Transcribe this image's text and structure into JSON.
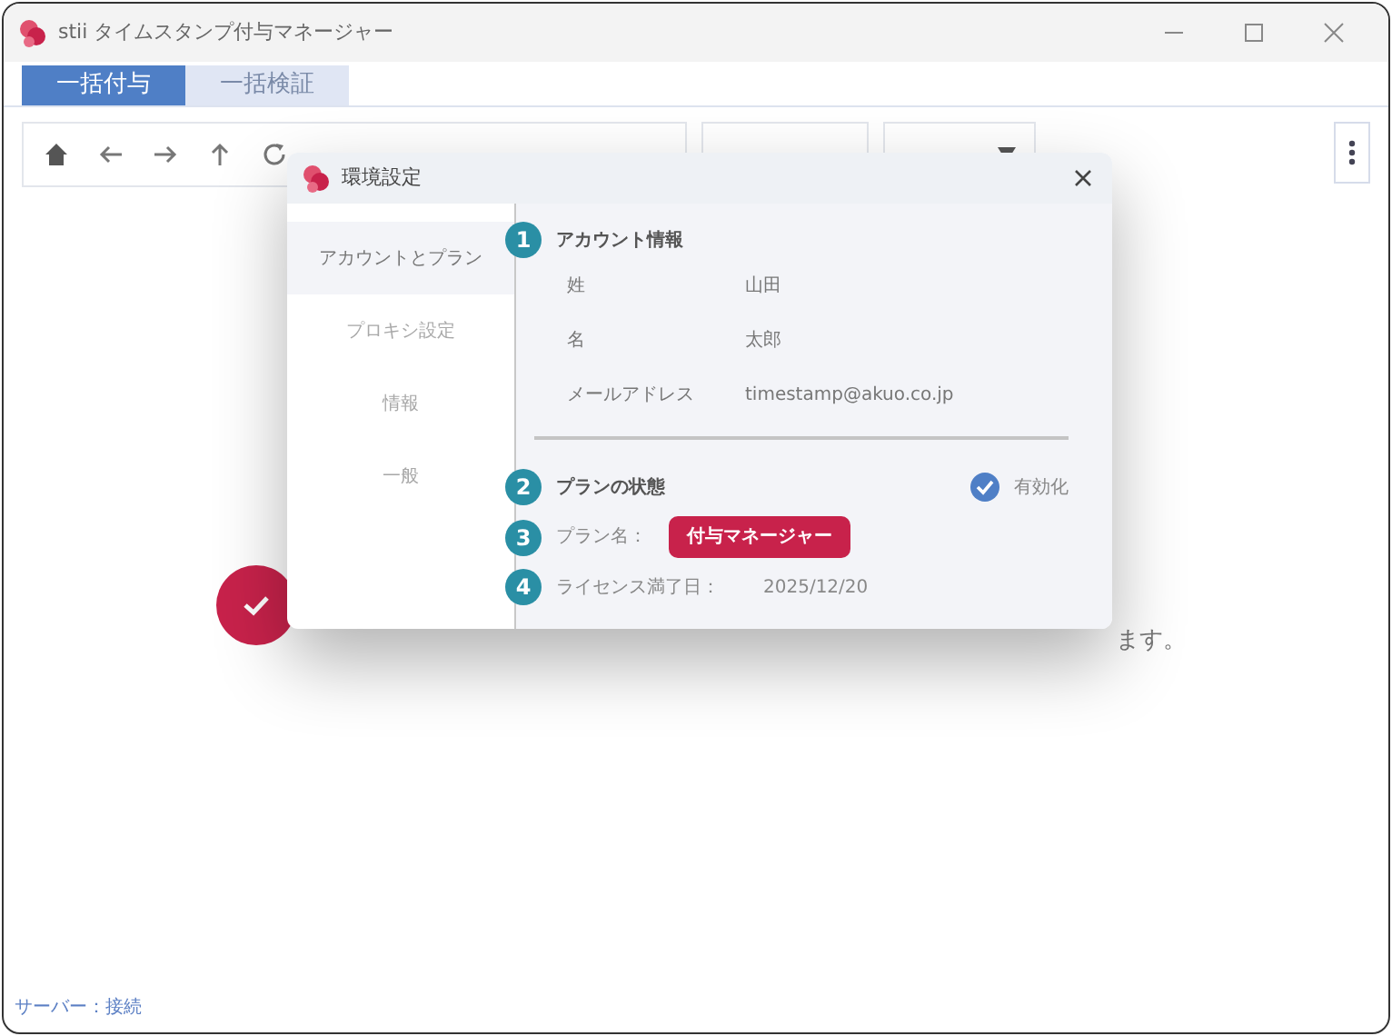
{
  "window": {
    "title": "stii タイムスタンプ付与マネージャー"
  },
  "tabs": [
    {
      "label": "一括付与",
      "selected": true
    },
    {
      "label": "一括検証",
      "selected": false
    }
  ],
  "toolbar": {
    "buttons": [
      {
        "kind": "plain"
      },
      {
        "kind": "dropdown"
      }
    ]
  },
  "background_message": {
    "text": "ます。"
  },
  "dialog": {
    "title": "環境設定",
    "nav": [
      {
        "label": "アカウントとプラン",
        "selected": true
      },
      {
        "label": "プロキシ設定",
        "selected": false
      },
      {
        "label": "情報",
        "selected": false
      },
      {
        "label": "一般",
        "selected": false
      }
    ],
    "account": {
      "marker": "1",
      "title": "アカウント情報",
      "fields": [
        {
          "label": "姓",
          "value": "山田"
        },
        {
          "label": "名",
          "value": "太郎"
        },
        {
          "label": "メールアドレス",
          "value": "timestamp@akuo.co.jp"
        }
      ]
    },
    "plan": {
      "marker": "2",
      "title": "プランの状態",
      "status": {
        "label": "有効化",
        "checked": true
      },
      "plan_name": {
        "marker": "3",
        "label": "プラン名：",
        "value": "付与マネージャー"
      },
      "license": {
        "marker": "4",
        "label": "ライセンス満了日：",
        "value": "2025/12/20"
      }
    }
  },
  "status_bar": {
    "text": "サーバー：接続"
  }
}
